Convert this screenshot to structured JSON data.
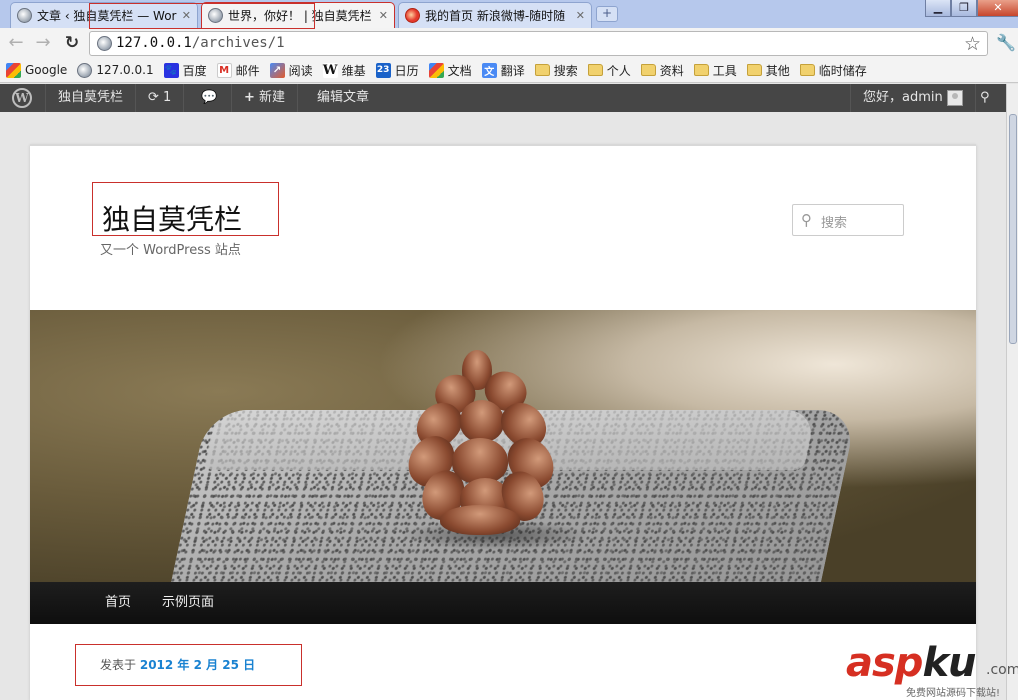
{
  "browser": {
    "tabs": [
      {
        "title": "文章 ‹ 独自莫凭栏 — Wor",
        "active": false
      },
      {
        "title": "世界，你好！ | 独自莫凭栏",
        "active": true
      },
      {
        "title": "我的首页 新浪微博-随时随",
        "active": false
      }
    ],
    "url_host": "127.0.0.1",
    "url_path": "/archives/1",
    "bookmarks": [
      {
        "label": "Google",
        "icon": "google-icon"
      },
      {
        "label": "127.0.0.1",
        "icon": "globe-icon"
      },
      {
        "label": "百度",
        "icon": "baidu-icon"
      },
      {
        "label": "邮件",
        "icon": "gmail-icon"
      },
      {
        "label": "阅读",
        "icon": "reader-icon"
      },
      {
        "label": "维基",
        "icon": "wikipedia-icon"
      },
      {
        "label": "日历",
        "icon": "calendar-icon"
      },
      {
        "label": "文档",
        "icon": "docs-icon"
      },
      {
        "label": "翻译",
        "icon": "translate-icon"
      },
      {
        "label": "搜索",
        "icon": "folder-icon"
      },
      {
        "label": "个人",
        "icon": "folder-icon"
      },
      {
        "label": "资料",
        "icon": "folder-icon"
      },
      {
        "label": "工具",
        "icon": "folder-icon"
      },
      {
        "label": "其他",
        "icon": "folder-icon"
      },
      {
        "label": "临时储存",
        "icon": "folder-icon"
      }
    ],
    "calendar_day": "23"
  },
  "adminbar": {
    "site_name": "独自莫凭栏",
    "updates_count": "1",
    "new_label": "新建",
    "edit_label": "编辑文章",
    "greeting": "您好，admin"
  },
  "site": {
    "title": "独自莫凭栏",
    "description": "又一个 WordPress 站点",
    "search_placeholder": "搜索",
    "nav": [
      "首页",
      "示例页面"
    ]
  },
  "post": {
    "meta_prefix": "发表于",
    "date": "2012 年 2 月 25 日"
  },
  "watermark": {
    "logo_a": "asp",
    "logo_b": "ku",
    "dotcom": ".com",
    "tagline": "免费网站源码下载站!"
  }
}
